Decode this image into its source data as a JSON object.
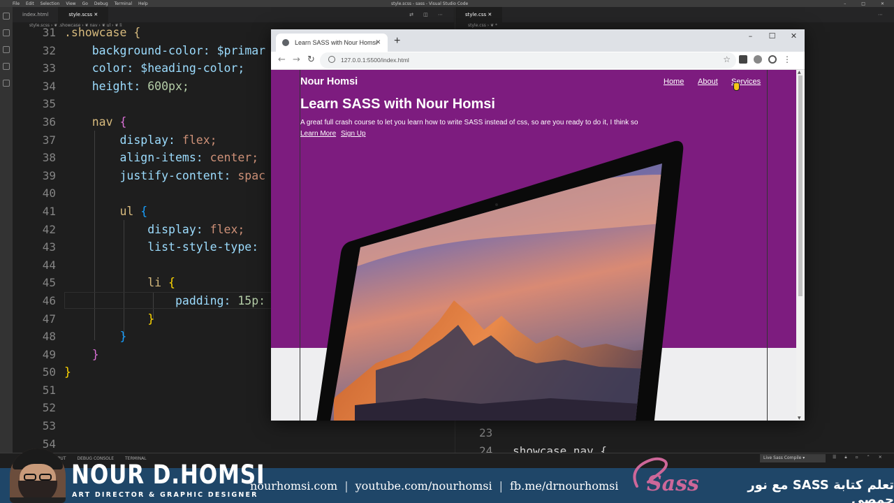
{
  "vscode": {
    "window_title": "style.scss - sass - Visual Studio Code",
    "menu": [
      "File",
      "Edit",
      "Selection",
      "View",
      "Go",
      "Debug",
      "Terminal",
      "Help"
    ],
    "tabs": [
      "index.html",
      "style.scss"
    ],
    "breadcrumb": "style.scss › ❦ .showcase › ❦ nav › ❦ ul › ❦ li",
    "right_tab": "style.css",
    "right_breadcrumb": "style.css › ❦ *",
    "right_line_23": "23",
    "right_line_24": "24",
    "right_line_24_code": ".showcase nav {",
    "line_numbers": [
      "31",
      "32",
      "33",
      "34",
      "35",
      "36",
      "37",
      "38",
      "39",
      "40",
      "41",
      "42",
      "43",
      "44",
      "45",
      "46",
      "47",
      "48",
      "49",
      "50",
      "51",
      "52",
      "53",
      "54"
    ],
    "code": {
      "l31": ".showcase {",
      "l32_prop": "background-color:",
      "l32_val": "$primar",
      "l33_prop": "color:",
      "l33_val": "$heading-color;",
      "l34_prop": "height:",
      "l34_val": "600px;",
      "l36_sel": "nav",
      "l36_brace": "{",
      "l37_prop": "display:",
      "l37_val": "flex;",
      "l38_prop": "align-items:",
      "l38_val": "center;",
      "l39_prop": "justify-content:",
      "l39_val": "spac",
      "l41_sel": "ul",
      "l41_brace": "{",
      "l42_prop": "display:",
      "l42_val": "flex;",
      "l43_prop": "list-style-type:",
      "l45_sel": "li",
      "l45_brace": "{",
      "l46_prop": "padding:",
      "l46_val": "15p:",
      "l47": "}",
      "l48": "}",
      "l49": "}",
      "l50": "}"
    },
    "panel_tabs": [
      "OUTPUT",
      "DEBUG CONSOLE",
      "TERMINAL"
    ],
    "panel_select": "Live Sass Compile"
  },
  "browser": {
    "tab_title": "Learn SASS with Nour Homsi",
    "url": "127.0.0.1:5500/index.html",
    "page": {
      "brand": "Nour Homsi",
      "nav": [
        "Home",
        "About",
        "Services"
      ],
      "heading": "Learn SASS with Nour Homsi",
      "lead": "A great full crash course to let you learn how to write SASS instead of css, so are you ready to do it, I think so",
      "cta": [
        "Learn More",
        "Sign Up"
      ]
    }
  },
  "overlay": {
    "name": "NOUR D.HOMSI",
    "role": "ART DIRECTOR & GRAPHIC DESIGNER",
    "links": [
      "nourhomsi.com",
      "youtube.com/nourhomsi",
      "fb.me/drnourhomsi"
    ],
    "sass_logo": "Sass",
    "arabic_title": "تعلم كتابة SASS مع نور حمصي"
  },
  "colors": {
    "showcase_bg": "#7d1c7f",
    "strip_bg": "#1f4668",
    "sass_pink": "#cd6799"
  }
}
